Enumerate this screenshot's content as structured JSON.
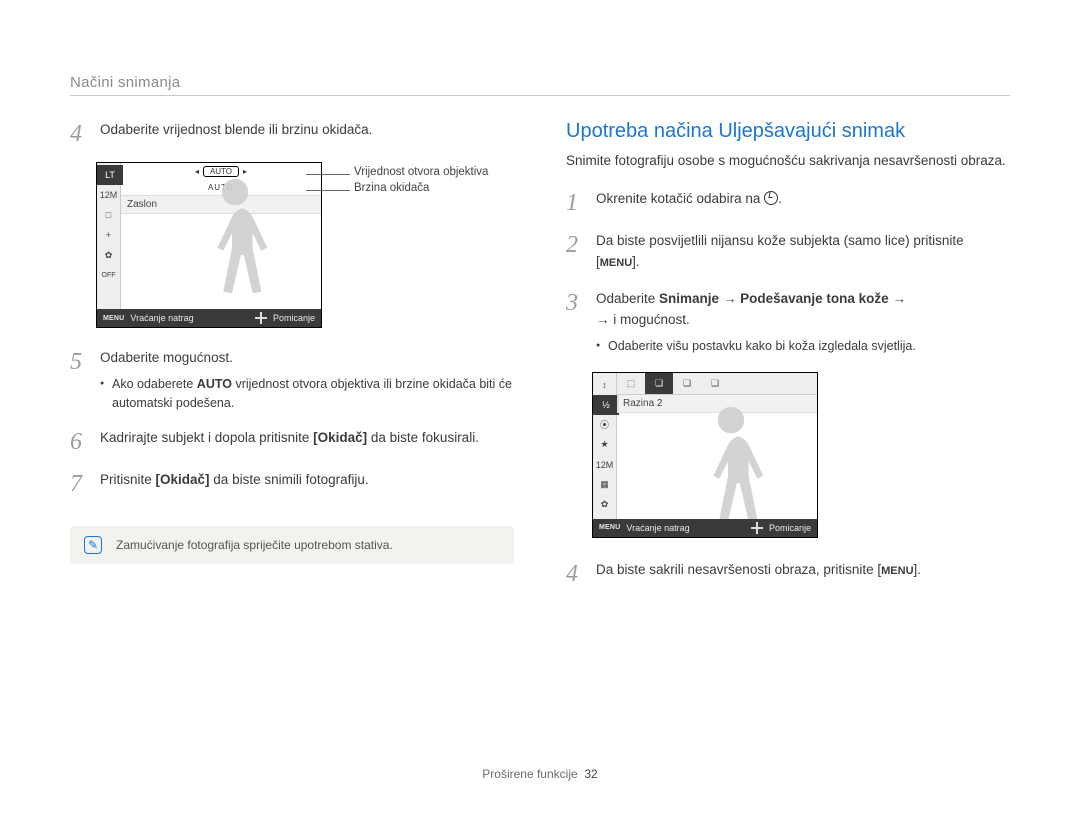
{
  "section_title": "Načini snimanja",
  "left": {
    "step4": "Odaberite vrijednost blende ili brzinu okidača.",
    "cam": {
      "mode_label": "LT",
      "icons": [
        "12M",
        "□",
        "+",
        "✿",
        "⚙",
        "OFF"
      ],
      "auto_pill": "AUTO",
      "auto_label2": "AUTO",
      "screen_label": "Zaslon",
      "status_menu": "MENU",
      "status_back": "Vraćanje natrag",
      "status_move": "Pomicanje"
    },
    "pointer1": "Vrijednost otvora objektiva",
    "pointer2": "Brzina okidača",
    "step5": "Odaberite mogućnost.",
    "step5_sub_pre": "Ako odaberete ",
    "step5_sub_bold": "AUTO",
    "step5_sub_post": " vrijednost otvora objektiva ili brzine okidača biti će automatski podešena.",
    "step6_pre": "Kadrirajte subjekt i dopola pritisnite ",
    "step6_bold": "[Okidač]",
    "step6_post": " da biste fokusirali.",
    "step7_pre": "Pritisnite ",
    "step7_bold": "[Okidač]",
    "step7_post": " da biste snimili fotografiju.",
    "note": "Zamućivanje fotografija spriječite upotrebom stativa."
  },
  "right": {
    "heading": "Upotreba načina Uljepšavajući snimak",
    "intro": "Snimite fotografiju osobe s mogućnošću sakrivanja nesavršenosti obraza.",
    "step1_pre": "Okrenite kotačić odabira na ",
    "step1_post": ".",
    "step2_pre": "Da biste posvijetlili nijansu kože subjekta (samo lice) pritisnite [",
    "step2_menu": "MENU",
    "step2_post": "].",
    "step3_pre": "Odaberite ",
    "step3_b1": "Snimanje",
    "step3_arrow": " → ",
    "step3_b2": "Podešavanje tona kože",
    "step3_post": " → i mogućnost.",
    "step3_sub": "Odaberite višu postavku kako bi koža izgledala svjetlija.",
    "cam": {
      "icons_top": [
        "⬚",
        "❏",
        "❏",
        "❏"
      ],
      "icons_left": [
        "↕",
        "½",
        "⦿",
        "★",
        "12M",
        "▦",
        "✿"
      ],
      "screen_label": "Razina 2",
      "status_menu": "MENU",
      "status_back": "Vraćanje natrag",
      "status_move": "Pomicanje"
    },
    "step4_pre": "Da biste sakrili nesavršenosti obraza, pritisnite [",
    "step4_menu": "MENU",
    "step4_post": "]."
  },
  "footer_label": "Proširene funkcije",
  "page_number": "32"
}
